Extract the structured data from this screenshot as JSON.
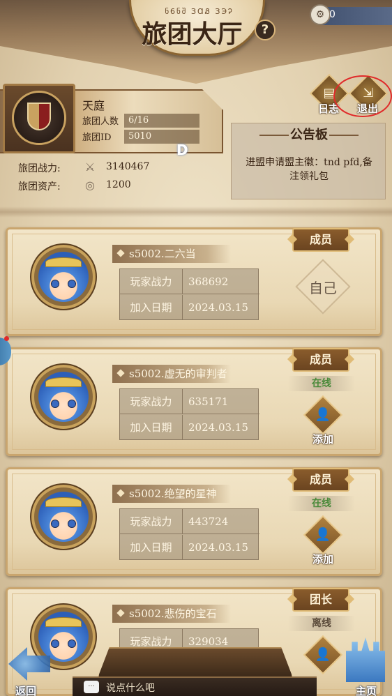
{
  "header": {
    "runes": "ნ6ნშ ЗⱭᏰ ЗЭᎮ",
    "title": "旅团大厅",
    "help_glyph": "?",
    "currency_icon": "gear-coin-icon",
    "currency_value": "0"
  },
  "guild": {
    "name": "天庭",
    "members_label": "旅团人数",
    "members_value": "6/16",
    "id_label": "旅团ID",
    "id_value": "5010",
    "power_label": "旅团战力:",
    "power_icon": "crossed-swords-icon",
    "power_value": "3140467",
    "assets_label": "旅团资产:",
    "assets_icon": "coin-pile-icon",
    "assets_value": "1200",
    "overlay_letter": "D"
  },
  "top_actions": {
    "log_label": "日志",
    "exit_label": "退出"
  },
  "notice": {
    "title": "公告板",
    "body": "进盟申请盟主徽：tnd pfd,备注领礼包"
  },
  "labels": {
    "power": "玩家战力",
    "join_date": "加入日期",
    "add": "添加",
    "self": "自己"
  },
  "members": [
    {
      "name": "s5002.二六当",
      "role": "成员",
      "status": "",
      "power": "368692",
      "join_date": "2024.03.15",
      "is_self": true
    },
    {
      "name": "s5002.虚无的审判者",
      "role": "成员",
      "status": "在线",
      "power": "635171",
      "join_date": "2024.03.15",
      "is_self": false
    },
    {
      "name": "s5002.绝望的星神",
      "role": "成员",
      "status": "在线",
      "power": "443724",
      "join_date": "2024.03.15",
      "is_self": false
    },
    {
      "name": "s5002.悲伤的宝石",
      "role": "团长",
      "status": "离线",
      "power": "329034",
      "join_date": "",
      "is_self": false
    }
  ],
  "bottom": {
    "back_label": "返回",
    "chat_placeholder": "说点什么吧",
    "chat_icon_text": "···",
    "home_label": "主页"
  },
  "colors": {
    "online": "#4a8a3a",
    "highlight_circle": "#e02a2a",
    "parchment": "#efe3c8"
  }
}
